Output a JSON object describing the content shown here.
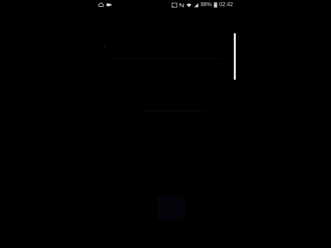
{
  "status_bar": {
    "left_icons": [
      "cloud-icon",
      "video-camera-icon"
    ],
    "right_icons": [
      "cast-icon",
      "nfc-icon",
      "wifi-icon",
      "signal-icon"
    ],
    "battery_percent": "88%",
    "time": "02:42"
  },
  "screen": {
    "state": "dark-dimmed",
    "edge_panel_handle_color": "#e6e6e6",
    "background_color": "#000000"
  }
}
